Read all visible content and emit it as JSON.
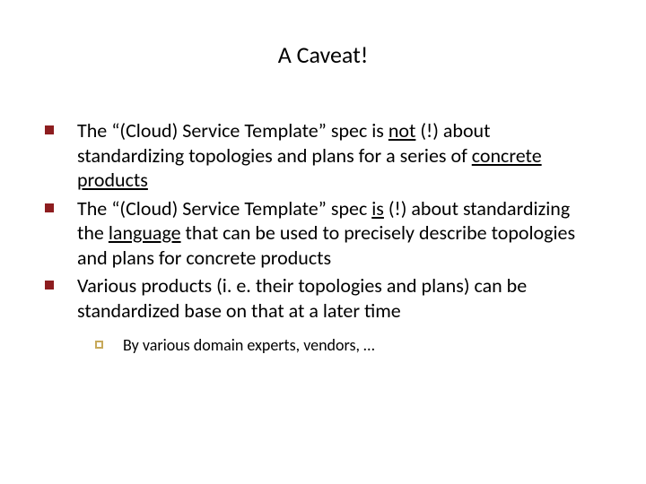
{
  "title": "A Caveat!",
  "bullets": {
    "b1": {
      "p1": "The “(Cloud) Service Template” spec is ",
      "u1": "not",
      "p2": " (!) about standardizing topologies and plans for a series of ",
      "u2": "concrete products"
    },
    "b2": {
      "p1": "The “(Cloud) Service Template” spec ",
      "u1": "is",
      "p2": " (!) about standardizing the ",
      "u2": "language",
      "p3": " that can be used to precisely describe topologies and plans for concrete products"
    },
    "b3": {
      "p1": "Various products (i. e. their topologies and plans) can be standardized base on that at a later time"
    },
    "sub1": "By various domain experts, vendors, …"
  }
}
